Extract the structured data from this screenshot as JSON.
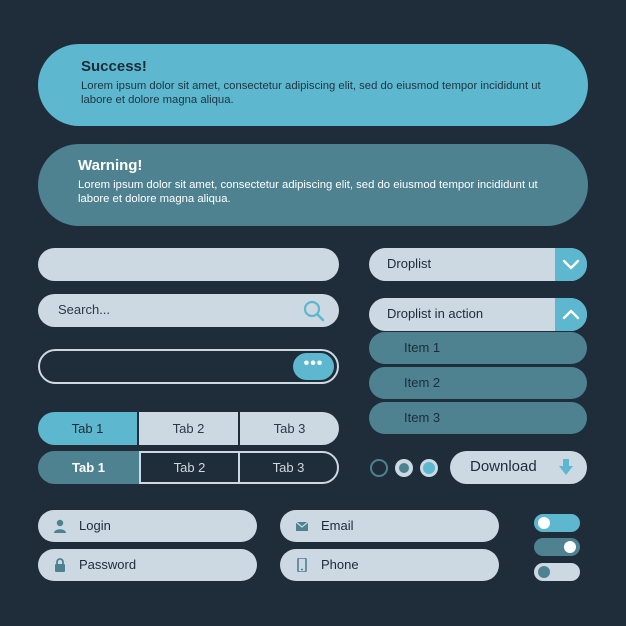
{
  "alerts": {
    "success": {
      "title": "Success!",
      "body": "Lorem ipsum dolor sit amet, consectetur adipiscing elit, sed do eiusmod tempor incididunt ut labore et dolore magna aliqua."
    },
    "warning": {
      "title": "Warning!",
      "body": "Lorem ipsum dolor sit amet, consectetur adipiscing elit, sed do eiusmod tempor incididunt ut labore et dolore magna aliqua."
    }
  },
  "inputs": {
    "plain": {
      "value": ""
    },
    "search": {
      "placeholder": "Search...",
      "icon": "search-icon"
    },
    "action": {
      "value": "",
      "button_icon": "ellipsis-icon"
    }
  },
  "tabs": {
    "row1": [
      "Tab 1",
      "Tab 2",
      "Tab 3"
    ],
    "row2": [
      "Tab 1",
      "Tab 2",
      "Tab 3"
    ],
    "selected": 0
  },
  "droplist": {
    "closed": {
      "label": "Droplist",
      "icon": "chevron-down-icon"
    },
    "open": {
      "label": "Droplist in action",
      "icon": "chevron-up-icon"
    },
    "items": [
      "Item 1",
      "Item 2",
      "Item 3"
    ]
  },
  "radios": {
    "selected": 2,
    "count": 3
  },
  "download": {
    "label": "Download",
    "icon": "download-arrow-icon"
  },
  "form": {
    "login": {
      "label": "Login",
      "icon": "user-icon"
    },
    "password": {
      "label": "Password",
      "icon": "lock-icon"
    },
    "email": {
      "label": "Email",
      "icon": "envelope-icon"
    },
    "phone": {
      "label": "Phone",
      "icon": "phone-icon"
    }
  },
  "toggles": [
    {
      "state": "off-blue"
    },
    {
      "state": "on"
    },
    {
      "state": "off-grey"
    }
  ],
  "colors": {
    "background": "#1f2d3a",
    "accent": "#5db7cf",
    "accent_dark": "#4e8291",
    "light": "#ccd8e2"
  }
}
